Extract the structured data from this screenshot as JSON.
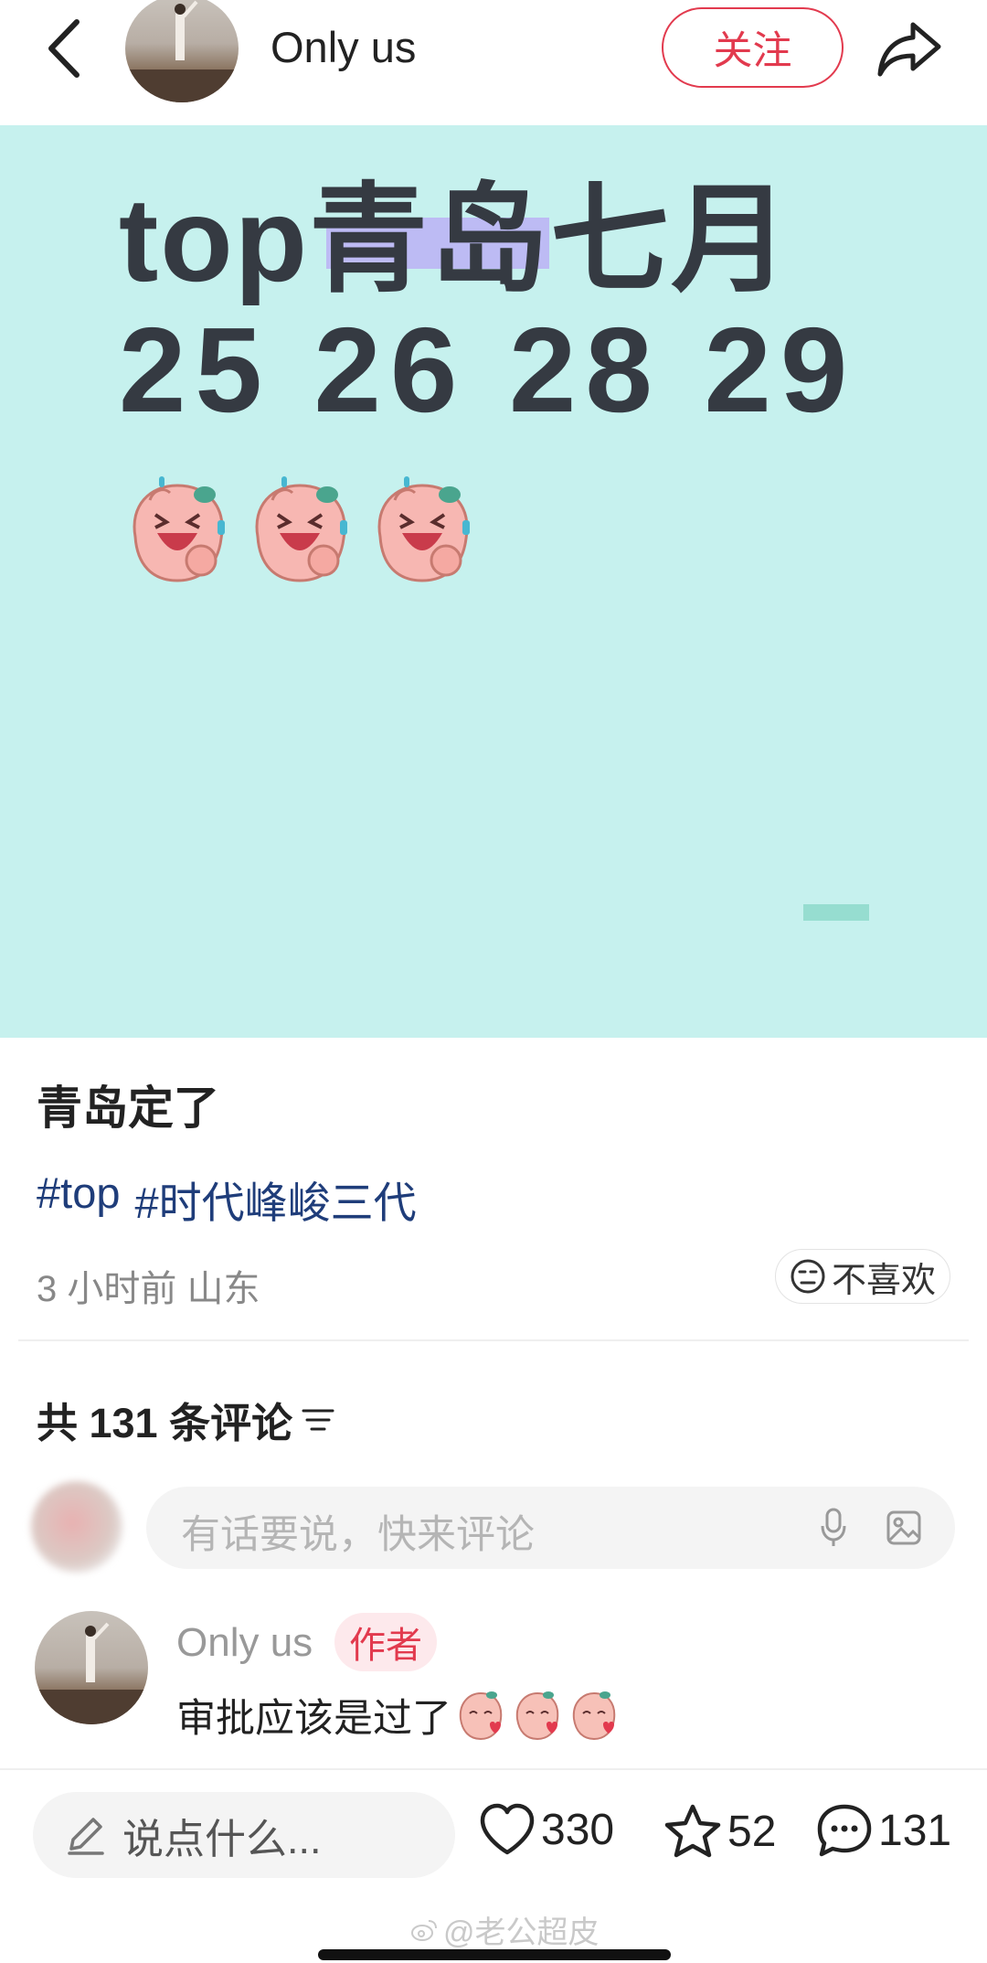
{
  "header": {
    "author_name": "Only us",
    "follow_label": "关注",
    "back_icon": "chevron-left-icon",
    "share_icon": "share-arrow-icon"
  },
  "post_image": {
    "line1_latin": "top",
    "line1_cjk": "青岛七月",
    "line2": "25 26 28 29",
    "background": "#c6f1ee",
    "text_color": "#353a42",
    "highlight_color": "#b9a8f5",
    "sticker_icon": "laughing-peach-sticker-icon",
    "sticker_count": 3
  },
  "post": {
    "title": "青岛定了",
    "tags": [
      "#top",
      "#时代峰峻三代"
    ],
    "meta": "3 小时前 山东",
    "dislike_label": "不喜欢"
  },
  "comments": {
    "count_label": "共 131 条评论",
    "input_placeholder": "有话要说，快来评论",
    "items": [
      {
        "author": "Only us",
        "badge": "作者",
        "text": "审批应该是过了"
      }
    ]
  },
  "bottom_bar": {
    "say_placeholder": "说点什么...",
    "likes": "330",
    "stars": "52",
    "comments": "131",
    "watermark": "@老公超皮"
  },
  "colors": {
    "accent": "#e23a4e",
    "tag_blue": "#1f3d7a"
  }
}
